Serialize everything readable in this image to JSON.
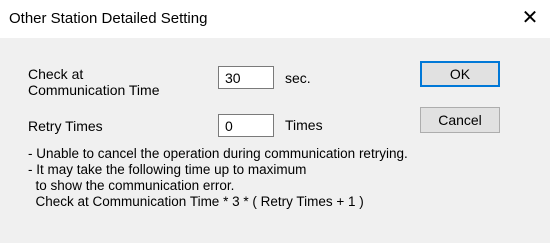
{
  "window": {
    "title": "Other Station Detailed Setting",
    "close_glyph": "✕"
  },
  "form": {
    "check_label_line1": "Check at",
    "check_label_line2": "Communication Time",
    "check_value": "30",
    "check_unit": "sec.",
    "retry_label": "Retry Times",
    "retry_value": "0",
    "retry_unit": "Times"
  },
  "buttons": {
    "ok_label": "OK",
    "cancel_label": "Cancel"
  },
  "notes": [
    "- Unable to cancel the operation during communication retrying.",
    "- It may take the following time up to maximum",
    "  to show the communication error.",
    "  Check at Communication Time * 3 * ( Retry Times + 1 )"
  ]
}
